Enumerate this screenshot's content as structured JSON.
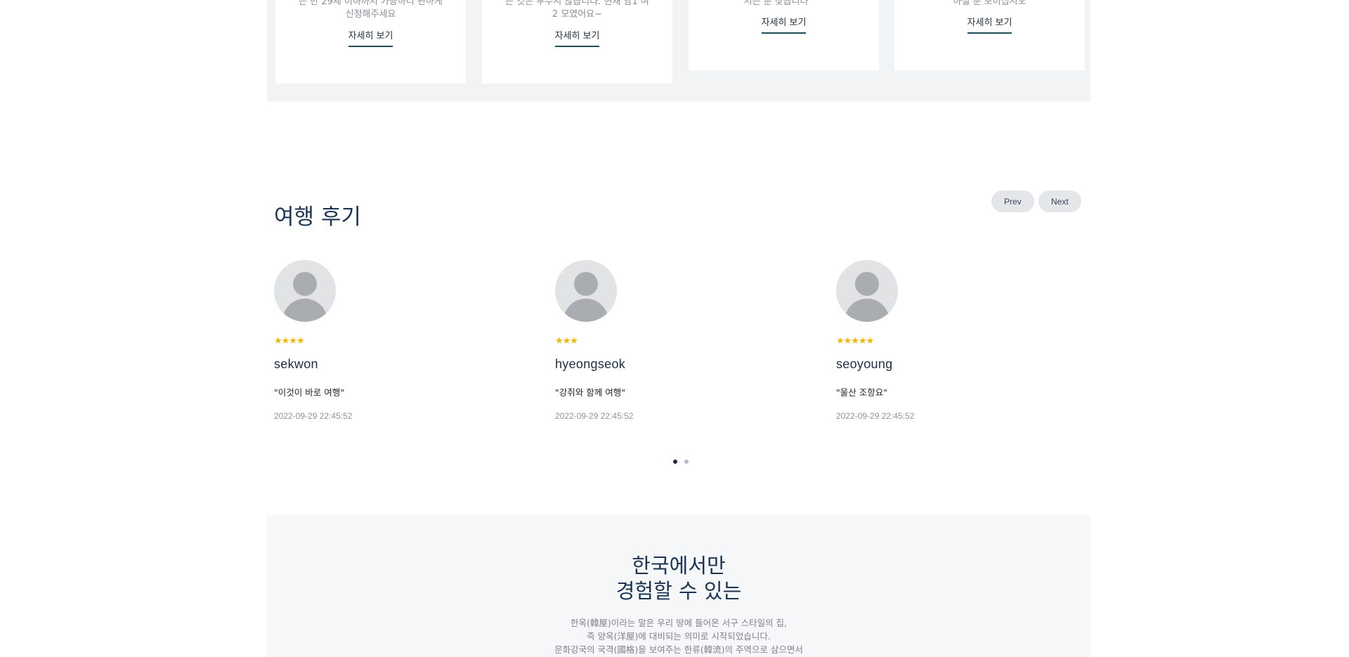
{
  "cards": [
    {
      "desc_lines": [
        "는 만 29세 이하까지 가능하니 편하게",
        "신청해주세요"
      ],
      "link": "자세히 보기"
    },
    {
      "desc_lines": [
        "든 것은 부수지 않습니다. 현재 남1 여",
        "2 모였어요~"
      ],
      "link": "자세히 보기"
    },
    {
      "desc_lines": [
        "시는 분 찾습니다^^"
      ],
      "link": "자세히 보기"
    },
    {
      "desc_lines": [
        "하실 분 모이십시오"
      ],
      "link": "자세히 보기"
    }
  ],
  "reviews_section": {
    "title": "여행 후기",
    "prev_label": "Prev",
    "next_label": "Next",
    "items": [
      {
        "stars": "★★★★",
        "rating": 4,
        "name": "sekwon",
        "quote": "\"이것이 바로 여행\"",
        "date": "2022-09-29 22:45:52"
      },
      {
        "stars": "★★★",
        "rating": 3,
        "name": "hyeongseok",
        "quote": "\"강쥐와 함께 여행\"",
        "date": "2022-09-29 22:45:52"
      },
      {
        "stars": "★★★★★",
        "rating": 5,
        "name": "seoyoung",
        "quote": "\"울산 조항요\"",
        "date": "2022-09-29 22:45:52"
      }
    ],
    "pagination": {
      "current": 1,
      "total": 2
    }
  },
  "korea_section": {
    "title_line1": "한국에서만",
    "title_line2": "경험할 수 있는",
    "desc_lines": [
      "한옥(韓屋)이라는 말은 우리 땅에 들어온 서구 스타일의 집,",
      "즉 양옥(洋屋)에 대비되는 의미로 시작되었습니다.",
      "문화강국의 국격(國格)을 보여주는 한류(韓流)의 주역으로 삼으면서"
    ]
  },
  "colors": {
    "accent": "#1e4d5a",
    "star": "#f2b705",
    "heading": "#1b3454",
    "section_bg": "#f2f3f5"
  }
}
